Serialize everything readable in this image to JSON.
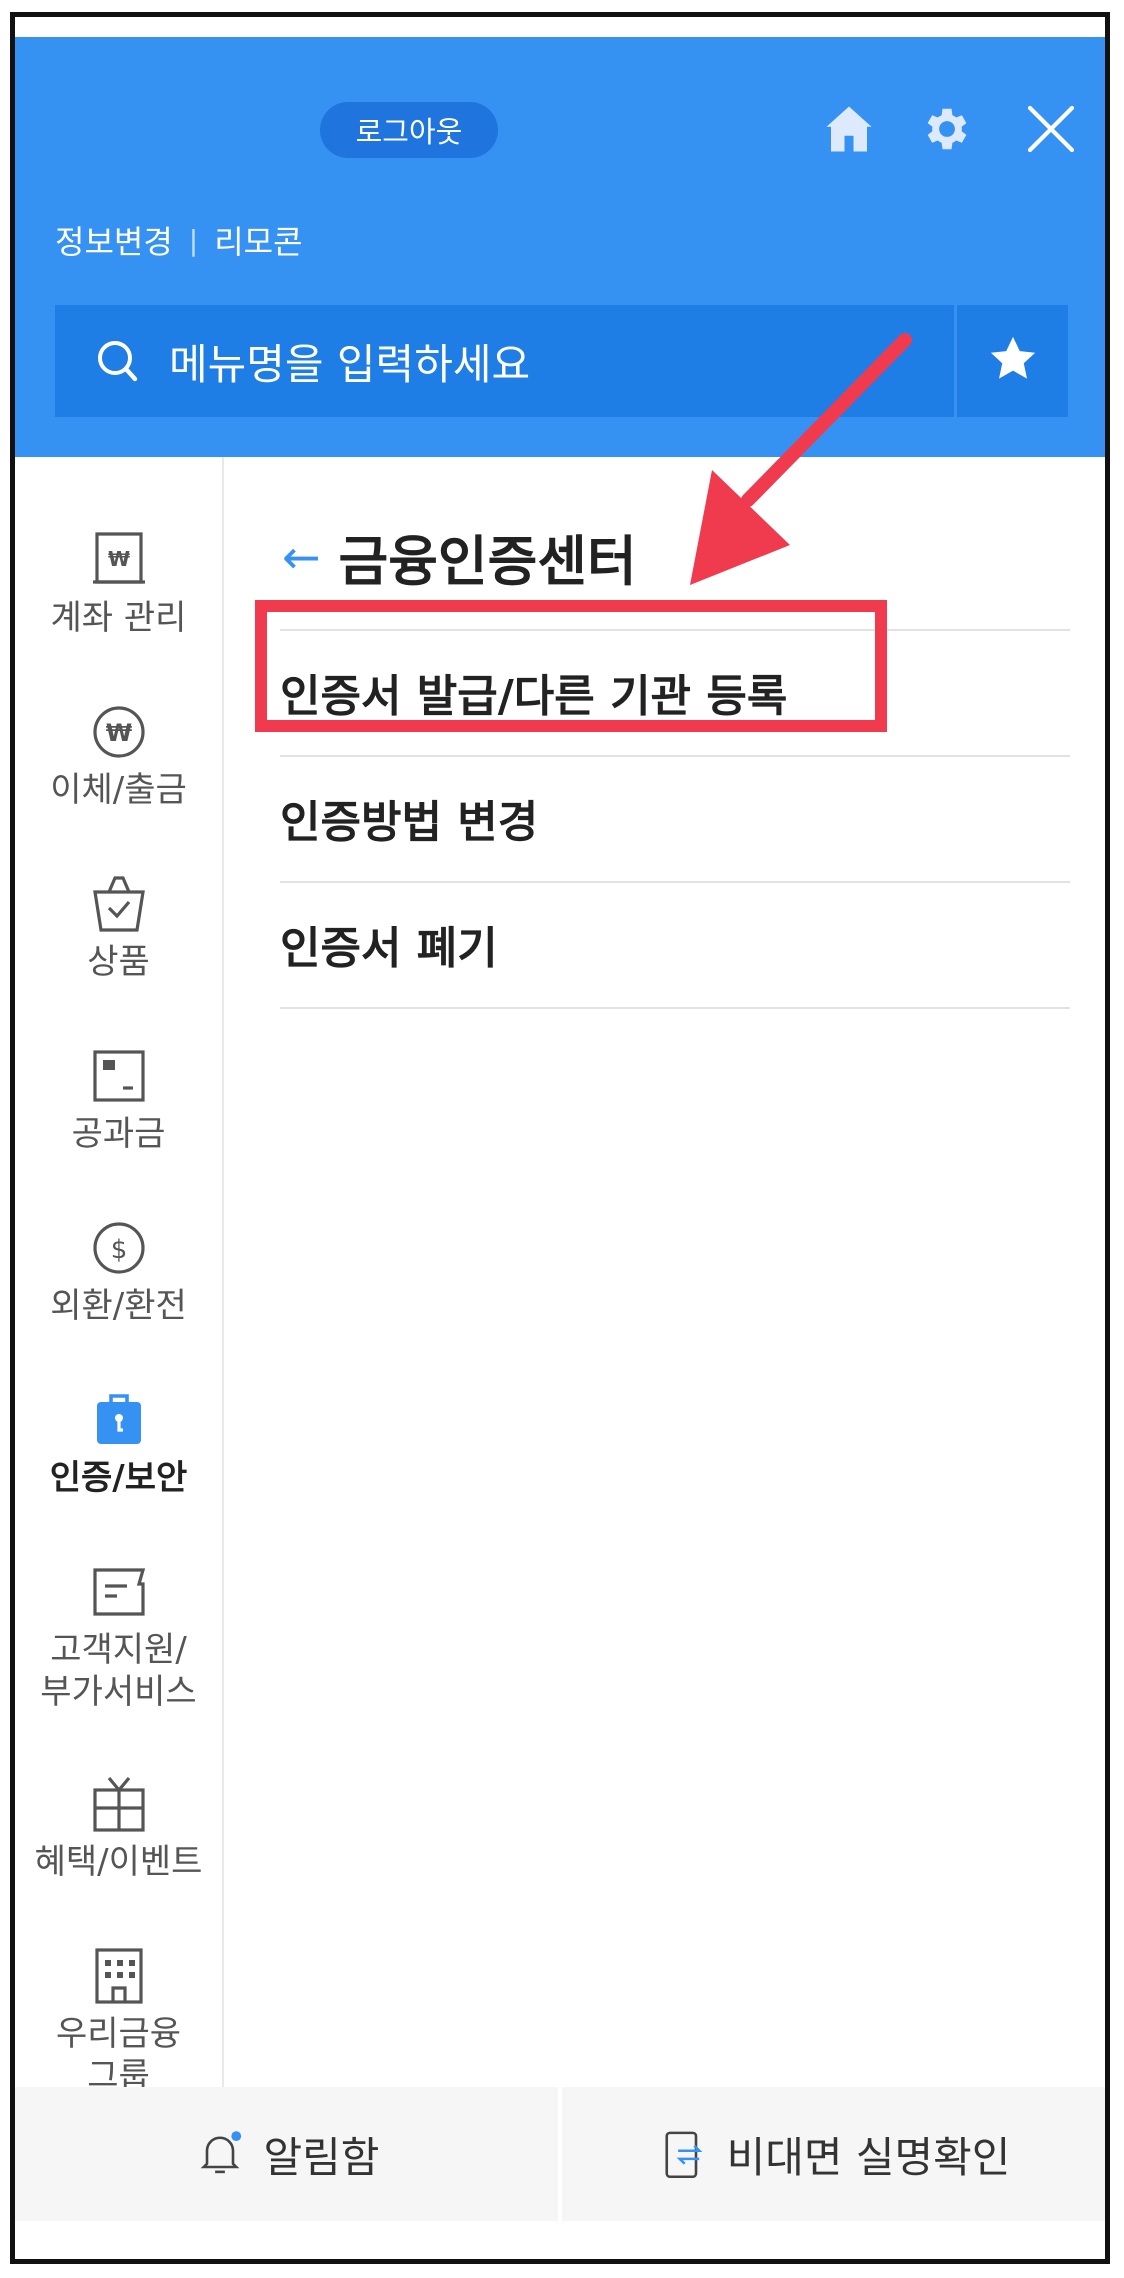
{
  "header": {
    "logout_label": "로그아웃",
    "links": [
      "정보변경",
      "리모콘"
    ],
    "separator": "|",
    "search_placeholder": "메뉴명을 입력하세요",
    "icons": [
      "home-icon",
      "gear-icon",
      "close-icon",
      "search-icon",
      "star-icon"
    ]
  },
  "sidebar": {
    "items": [
      {
        "label": "계좌 관리",
        "icon": "won-book-icon"
      },
      {
        "label": "이체/출금",
        "icon": "won-coin-icon"
      },
      {
        "label": "상품",
        "icon": "shopping-bag-icon"
      },
      {
        "label": "공과금",
        "icon": "bill-icon"
      },
      {
        "label": "외환/환전",
        "icon": "dollar-coin-icon"
      },
      {
        "label": "인증/보안",
        "icon": "lock-icon",
        "active": true
      },
      {
        "label": "고객지원/\n부가서비스",
        "icon": "memo-icon"
      },
      {
        "label": "혜택/이벤트",
        "icon": "gift-icon"
      },
      {
        "label": "우리금융\n그룹",
        "icon": "building-icon"
      }
    ]
  },
  "main": {
    "back_arrow": "←",
    "title": "금융인증센터",
    "items": [
      "인증서 발급/다른 기관 등록",
      "인증방법 변경",
      "인증서 폐기"
    ]
  },
  "bottom": {
    "notifications_label": "알림함",
    "verify_label": "비대면 실명확인"
  },
  "colors": {
    "header_blue": "#3592f2",
    "search_blue": "#1f7de6",
    "annotation_red": "#f03a4e",
    "active_icon_blue": "#3592f2"
  }
}
